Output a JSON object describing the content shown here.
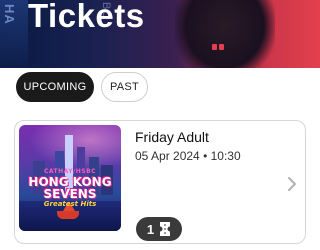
{
  "header": {
    "title": "Tickets",
    "side_text": "HA",
    "mid_text": "BO"
  },
  "tabs": [
    {
      "label": "UPCOMING",
      "active": true
    },
    {
      "label": "PAST",
      "active": false
    }
  ],
  "ticket": {
    "title": "Friday Adult",
    "date": "05 Apr 2024",
    "separator": "•",
    "time": "10:30",
    "count": "1",
    "poster": {
      "top_text": "CATHAY/HSBC",
      "line1": "HONG KONG",
      "line2": "SEVENS",
      "subtitle": "Greatest Hits"
    }
  },
  "icons": {
    "ticket": "ticket-icon",
    "chevron": "chevron-right-icon"
  },
  "colors": {
    "active_tab_bg": "#1a1a1a",
    "badge_bg": "#3a3a3a",
    "header_accent": "#e3404c"
  }
}
